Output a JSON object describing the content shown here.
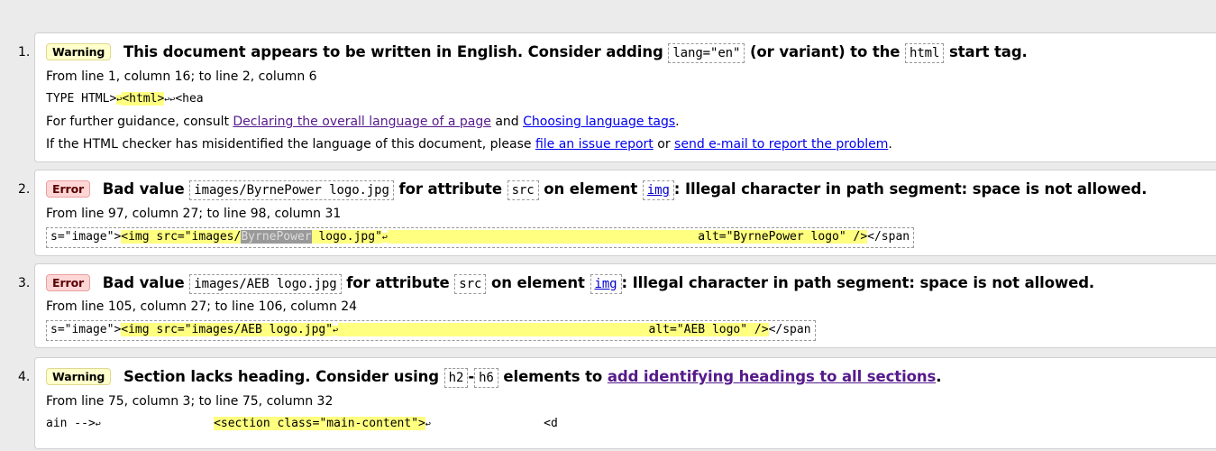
{
  "messages": [
    {
      "number": "1.",
      "type": "Warning",
      "head_text_1": "This document appears to be written in English. Consider adding",
      "head_code_1": "lang=\"en\"",
      "head_text_2": "(or variant) to the",
      "head_code_2": "html",
      "head_text_3": "start tag.",
      "location": "From line 1, column 16; to line 2, column 6",
      "extract_pre": "TYPE HTML>",
      "extract_lf1": "↩",
      "extract_hl": "<html>",
      "extract_lf2": "↩↩",
      "extract_post": "<hea",
      "guidance_prefix": "For further guidance, consult",
      "guidance_link1": "Declaring the overall language of a page",
      "guidance_and": "and",
      "guidance_link2": "Choosing language tags",
      "guidance_end": ".",
      "report_prefix": "If the HTML checker has misidentified the language of this document, please",
      "report_link1": "file an issue report",
      "report_or": "or",
      "report_link2": "send e-mail to report the problem",
      "report_end": "."
    },
    {
      "number": "2.",
      "type": "Error",
      "head_text_1": "Bad value",
      "head_code_1": "images/ByrnePower logo.jpg",
      "head_text_2": "for attribute",
      "head_code_2": "src",
      "head_text_3": "on element",
      "head_code_3": "img",
      "head_text_4": ": Illegal character in path segment: space is not allowed.",
      "location": "From line 97, column 27; to line 98, column 31",
      "extract_pre": "s=\"image\">",
      "extract_hl_a": "<img src=\"images/",
      "extract_sel": "ByrnePower",
      "extract_hl_b": " logo.jpg\"",
      "extract_lf": "↩",
      "extract_hl_c": "                                            alt=\"ByrnePower logo\" />",
      "extract_post": "</span"
    },
    {
      "number": "3.",
      "type": "Error",
      "head_text_1": "Bad value",
      "head_code_1": "images/AEB logo.jpg",
      "head_text_2": "for attribute",
      "head_code_2": "src",
      "head_text_3": "on element",
      "head_code_3": "img",
      "head_text_4": ": Illegal character in path segment: space is not allowed.",
      "location": "From line 105, column 27; to line 106, column 24",
      "extract_pre": "s=\"image\">",
      "extract_hl_a": "<img src=\"images/AEB logo.jpg\"",
      "extract_lf": "↩",
      "extract_hl_c": "                                            alt=\"AEB logo\" />",
      "extract_post": "</span"
    },
    {
      "number": "4.",
      "type": "Warning",
      "head_text_1": "Section lacks heading. Consider using",
      "head_code_1": "h2",
      "head_dash": "-",
      "head_code_2": "h6",
      "head_text_2": "elements to",
      "head_link": "add identifying headings to all sections",
      "head_end": ".",
      "location": "From line 75, column 3; to line 75, column 32",
      "extract_pre": "ain -->",
      "extract_lf1": "↩",
      "extract_gap": "                ",
      "extract_hl": "<section class=\"main-content\">",
      "extract_lf2": "↩",
      "extract_gap2": "                ",
      "extract_post": "<d"
    }
  ]
}
